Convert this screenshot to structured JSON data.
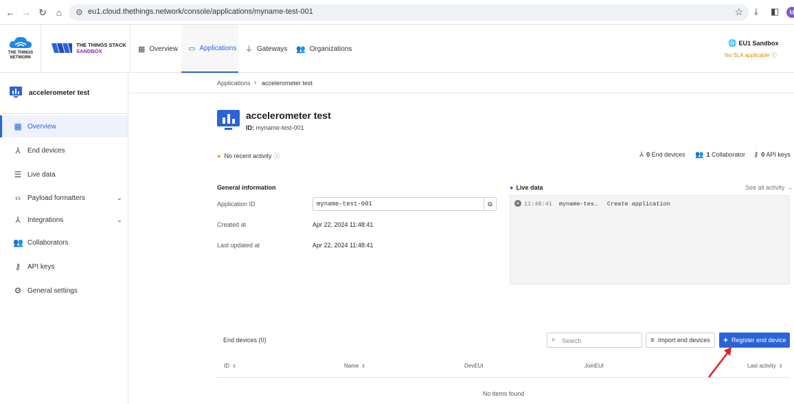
{
  "browser": {
    "url": "eu1.cloud.thethings.network/console/applications/myname-test-001",
    "profile_initial": "M"
  },
  "header": {
    "ttn_logo_text": "THE THINGS NETWORK",
    "stack_line1": "THE THINGS STACK",
    "stack_line2": "SANDBOX",
    "nav": [
      {
        "label": "Overview",
        "icon": "grid-icon"
      },
      {
        "label": "Applications",
        "icon": "window-icon"
      },
      {
        "label": "Gateways",
        "icon": "gateway-icon"
      },
      {
        "label": "Organizations",
        "icon": "people-icon"
      }
    ],
    "cluster": "EU1 Sandbox",
    "sla": "No SLA applicable"
  },
  "sidebar": {
    "app_name": "accelerometer test",
    "items": [
      {
        "label": "Overview"
      },
      {
        "label": "End devices"
      },
      {
        "label": "Live data"
      },
      {
        "label": "Payload formatters"
      },
      {
        "label": "Integrations"
      },
      {
        "label": "Collaborators"
      },
      {
        "label": "API keys"
      },
      {
        "label": "General settings"
      }
    ]
  },
  "breadcrumb": {
    "parent": "Applications",
    "current": "accelerometer test"
  },
  "app": {
    "title": "accelerometer test",
    "id_label": "ID:",
    "id_value": "myname-test-001",
    "activity": "No recent activity",
    "end_devices_count": "0",
    "end_devices_label": "End devices",
    "collaborators_count": "1",
    "collaborators_label": "Collaborator",
    "api_keys_count": "0",
    "api_keys_label": "API keys"
  },
  "general": {
    "title": "General information",
    "application_id_label": "Application ID",
    "application_id_value": "myname-test-001",
    "created_label": "Created at",
    "created_value": "Apr 22, 2024 11:48:41",
    "updated_label": "Last updated at",
    "updated_value": "Apr 22, 2024 11:48:41"
  },
  "live": {
    "title": "Live data",
    "see_all": "See all activity →",
    "events": [
      {
        "time": "11:48:41",
        "who": "myname-tes…",
        "text": "Create application"
      }
    ]
  },
  "end_devices": {
    "title": "End devices (0)",
    "search_placeholder": "Search",
    "import_label": "Import end devices",
    "register_label": "Register end device",
    "columns": [
      "ID",
      "Name",
      "DevEUI",
      "JoinEUI",
      "Last activity"
    ],
    "empty": "No items found"
  },
  "colors": {
    "accent": "#2b63d9",
    "warning": "#e08a00",
    "brand_purple": "#8e24aa",
    "annotation_arrow": "#e02020"
  }
}
